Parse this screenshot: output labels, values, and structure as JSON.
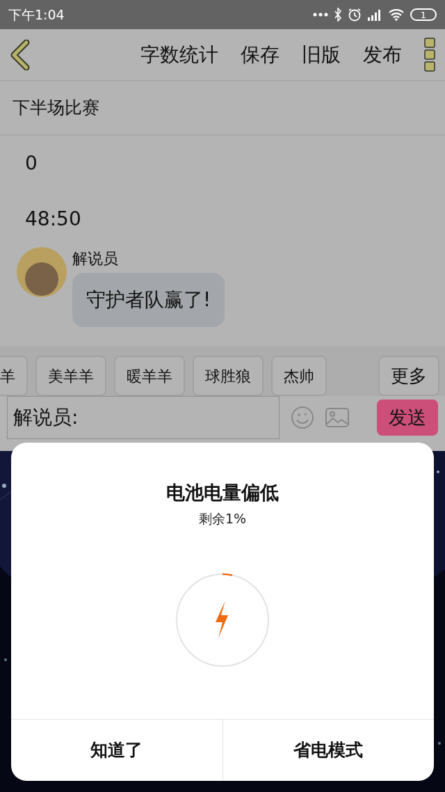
{
  "status_bar": {
    "time": "下午1:04",
    "battery": "1"
  },
  "toolbar": {
    "actions": [
      "字数统计",
      "保存",
      "旧版",
      "发布"
    ]
  },
  "title": "下半场比赛",
  "lines": [
    "0",
    "48:50"
  ],
  "messages": [
    {
      "author": "解说员",
      "text": "守护者队赢了!"
    }
  ],
  "quick_names": [
    "羊",
    "美羊羊",
    "暖羊羊",
    "球胜狼",
    "杰帅"
  ],
  "more_button": "更多",
  "composer": {
    "value": "解说员:",
    "send": "发送"
  },
  "dialog": {
    "title": "电池电量偏低",
    "subtitle": "剩余1%",
    "buttons": [
      "知道了",
      "省电模式"
    ]
  }
}
